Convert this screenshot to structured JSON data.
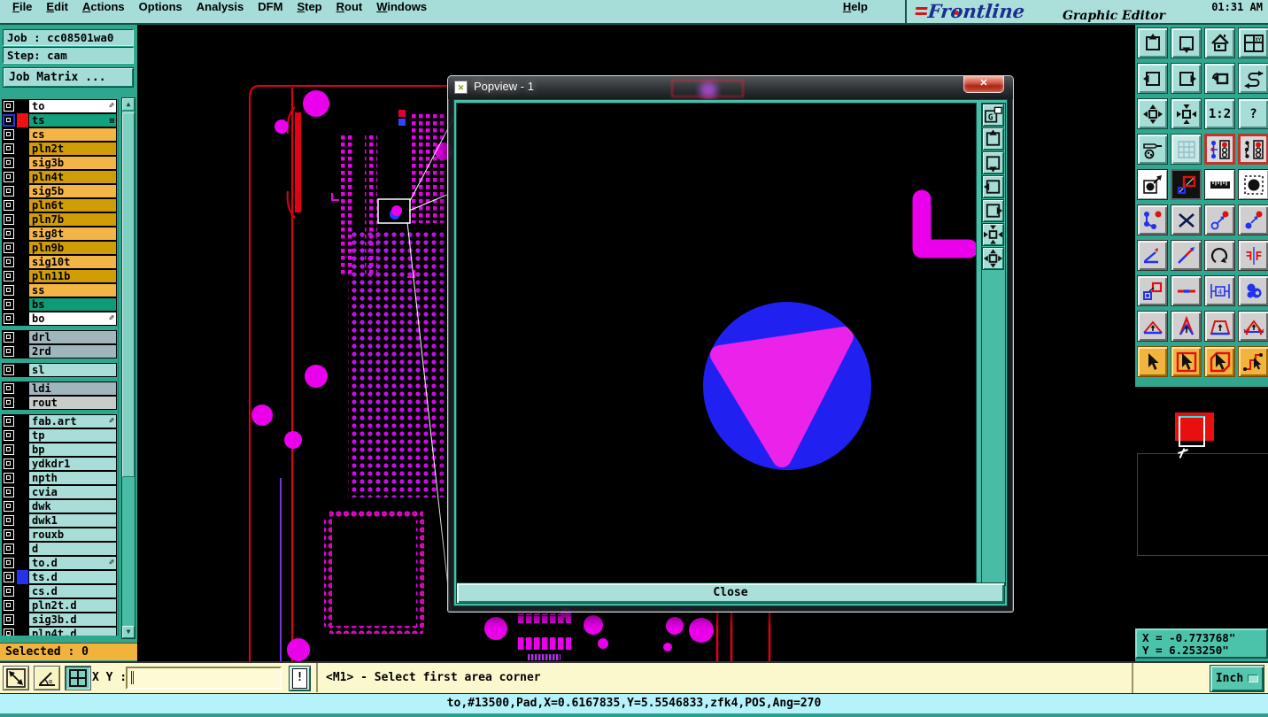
{
  "app": {
    "brand": "Frontline",
    "subtitle": "Graphic Editor",
    "time": "01:31 AM"
  },
  "menubar": {
    "items": [
      {
        "label": "File",
        "u": 0
      },
      {
        "label": "Edit",
        "u": 0
      },
      {
        "label": "Actions",
        "u": 0
      },
      {
        "label": "Options",
        "u": -1
      },
      {
        "label": "Analysis",
        "u": -1
      },
      {
        "label": "DFM",
        "u": -1
      },
      {
        "label": "Step",
        "u": 0
      },
      {
        "label": "Rout",
        "u": 0
      },
      {
        "label": "Windows",
        "u": 0
      },
      {
        "label": "Help",
        "u": 0,
        "right": true
      }
    ]
  },
  "job": {
    "job_label": "Job : cc08501wa0",
    "step_label": "Step: cam",
    "matrix_button": "Job Matrix ..."
  },
  "layers": {
    "colors": {
      "w": "#ffffff",
      "o": "#F2B546",
      "g": "#D19D07",
      "s": "#12A17D",
      "b": "#0E9B77",
      "d": "#9FB6BD",
      "t": "#A9DED8",
      "r": "#C9CDC9"
    },
    "groups": [
      {
        "rows": [
          {
            "n": "to",
            "c": "w",
            "ic": "pen"
          },
          {
            "n": "ts",
            "c": "s",
            "sw": "#EE1111",
            "cb": "sel",
            "ic": "grid"
          },
          {
            "n": "cs",
            "c": "o"
          },
          {
            "n": "pln2t",
            "c": "g"
          },
          {
            "n": "sig3b",
            "c": "o"
          },
          {
            "n": "pln4t",
            "c": "g"
          },
          {
            "n": "sig5b",
            "c": "o"
          },
          {
            "n": "pln6t",
            "c": "g"
          },
          {
            "n": "pln7b",
            "c": "g"
          },
          {
            "n": "sig8t",
            "c": "o"
          },
          {
            "n": "pln9b",
            "c": "g"
          },
          {
            "n": "sig10t",
            "c": "o"
          },
          {
            "n": "pln11b",
            "c": "g"
          },
          {
            "n": "ss",
            "c": "o"
          },
          {
            "n": "bs",
            "c": "b"
          },
          {
            "n": "bo",
            "c": "w",
            "ic": "pen"
          }
        ]
      },
      {
        "rows": [
          {
            "n": "drl",
            "c": "d"
          },
          {
            "n": "2rd",
            "c": "d"
          }
        ]
      },
      {
        "rows": [
          {
            "n": "sl",
            "c": "t"
          }
        ]
      },
      {
        "rows": [
          {
            "n": "ldi",
            "c": "d"
          },
          {
            "n": "rout",
            "c": "r"
          }
        ]
      },
      {
        "rows": [
          {
            "n": "fab.art",
            "c": "t",
            "ic": "pen"
          },
          {
            "n": "tp",
            "c": "t"
          },
          {
            "n": "bp",
            "c": "t"
          },
          {
            "n": "ydkdr1",
            "c": "t"
          },
          {
            "n": "npth",
            "c": "t"
          },
          {
            "n": "cvia",
            "c": "t"
          },
          {
            "n": "dwk",
            "c": "t"
          },
          {
            "n": "dwk1",
            "c": "t"
          },
          {
            "n": "rouxb",
            "c": "t"
          },
          {
            "n": "d",
            "c": "t"
          },
          {
            "n": "to.d",
            "c": "t",
            "ic": "pen"
          },
          {
            "n": "ts.d",
            "c": "t",
            "sw": "#2433E8"
          },
          {
            "n": "cs.d",
            "c": "t"
          },
          {
            "n": "pln2t.d",
            "c": "t"
          },
          {
            "n": "sig3b.d",
            "c": "t"
          },
          {
            "n": "pln4t.d",
            "c": "t"
          }
        ]
      }
    ]
  },
  "selected_label": "Selected : 0",
  "command": {
    "xy_label": "X Y :",
    "input_value": "",
    "alert": "!",
    "prompt": "<M1> - Select first area corner",
    "buttons": [
      {
        "n": "measure-distance-button",
        "i": "diag"
      },
      {
        "n": "measure-angle-button",
        "i": "anglealpha"
      },
      {
        "n": "snap-grid-button",
        "i": "win4",
        "active": true
      }
    ]
  },
  "status_bar": {
    "text": "to,#13500,Pad,X=0.6167835,Y=5.5546833,zfk4,POS,Ang=270"
  },
  "coords": {
    "x": "X = -0.773768\"",
    "y": "Y = 6.253250\"",
    "unit": "Inch"
  },
  "popview": {
    "title": "Popview - 1",
    "close_button": "Close",
    "icon": "window-x",
    "side_buttons": [
      {
        "n": "pv-goto-button",
        "i": "gwin"
      },
      {
        "n": "pv-zoom-in-button",
        "i": "boxup"
      },
      {
        "n": "pv-zoom-out-button",
        "i": "boxdown"
      },
      {
        "n": "pv-pan-left-button",
        "i": "boxleft"
      },
      {
        "n": "pv-pan-right-button",
        "i": "boxright"
      },
      {
        "n": "pv-center-view-button",
        "i": "arrowsin"
      },
      {
        "n": "pv-fit-view-button",
        "i": "arrowsout"
      }
    ]
  },
  "right_toolbar": {
    "buttons": [
      {
        "n": "zoom-in-button",
        "i": "boxup",
        "g": "t"
      },
      {
        "n": "zoom-out-button",
        "i": "boxdown",
        "g": "t"
      },
      {
        "n": "home-view-button",
        "i": "home",
        "g": "t"
      },
      {
        "n": "views-xy-button",
        "i": "winxy",
        "g": "t"
      },
      {
        "n": "pan-left-button",
        "i": "boxleft",
        "g": "t"
      },
      {
        "n": "pan-right-button",
        "i": "boxright",
        "g": "t"
      },
      {
        "n": "previous-view-button",
        "i": "undobox",
        "g": "t"
      },
      {
        "n": "redraw-button",
        "i": "sline",
        "g": "t"
      },
      {
        "n": "zoom-fit-button",
        "i": "arrowsout",
        "g": "t"
      },
      {
        "n": "pan-view-button",
        "i": "arrowsin",
        "g": "t"
      },
      {
        "n": "zoom-ratio-button",
        "txt": "1:2",
        "g": "t"
      },
      {
        "n": "help-query-button",
        "txt": "?",
        "g": "t"
      },
      {
        "n": "setup-tools-button",
        "i": "tools",
        "g": "t"
      },
      {
        "n": "grid-toggle-button",
        "i": "gridicon",
        "g": "t2"
      },
      {
        "n": "layer-display-button",
        "i": "traffic1",
        "g": "r"
      },
      {
        "n": "layer-display-alt-button",
        "i": "traffic2",
        "g": "r"
      },
      {
        "n": "select-feature-button",
        "i": "selcircle",
        "g": "w"
      },
      {
        "n": "swap-layers-button",
        "i": "swapsq",
        "g": "k"
      },
      {
        "n": "measure-button",
        "i": "ruler",
        "g": "w"
      },
      {
        "n": "pad-select-button",
        "i": "paddot",
        "g": "w"
      },
      {
        "n": "chain-select-button",
        "i": "chain",
        "g": "g"
      },
      {
        "n": "delete-button",
        "i": "delx",
        "g": "g"
      },
      {
        "n": "copy-to-layer-button",
        "i": "copycirc",
        "g": "g"
      },
      {
        "n": "move-to-layer-button",
        "i": "movecirc",
        "g": "g"
      },
      {
        "n": "angle-button",
        "i": "angle",
        "g": "g"
      },
      {
        "n": "slope-button",
        "i": "slope",
        "g": "g"
      },
      {
        "n": "rotate-button",
        "i": "rotate",
        "g": "g"
      },
      {
        "n": "mirror-button",
        "i": "mirror",
        "g": "g"
      },
      {
        "n": "copy-pad-button",
        "i": "copybox",
        "g": "g"
      },
      {
        "n": "stretch-button",
        "i": "stretch",
        "g": "g"
      },
      {
        "n": "resize-button",
        "i": "dimension",
        "g": "g"
      },
      {
        "n": "surface-button",
        "i": "surface",
        "g": "g"
      },
      {
        "n": "reshape-a-button",
        "i": "tri1",
        "g": "g"
      },
      {
        "n": "reshape-b-button",
        "i": "tri2",
        "g": "g"
      },
      {
        "n": "reshape-c-button",
        "i": "tri3",
        "g": "g"
      },
      {
        "n": "reshape-d-button",
        "i": "tri4",
        "g": "g"
      },
      {
        "n": "select-mode-button",
        "i": "cur1",
        "g": "o"
      },
      {
        "n": "select-frame-button",
        "i": "cur2",
        "g": "o"
      },
      {
        "n": "select-poly-button",
        "i": "cur3",
        "g": "o"
      },
      {
        "n": "select-net-button",
        "i": "cur4",
        "g": "o"
      }
    ]
  }
}
